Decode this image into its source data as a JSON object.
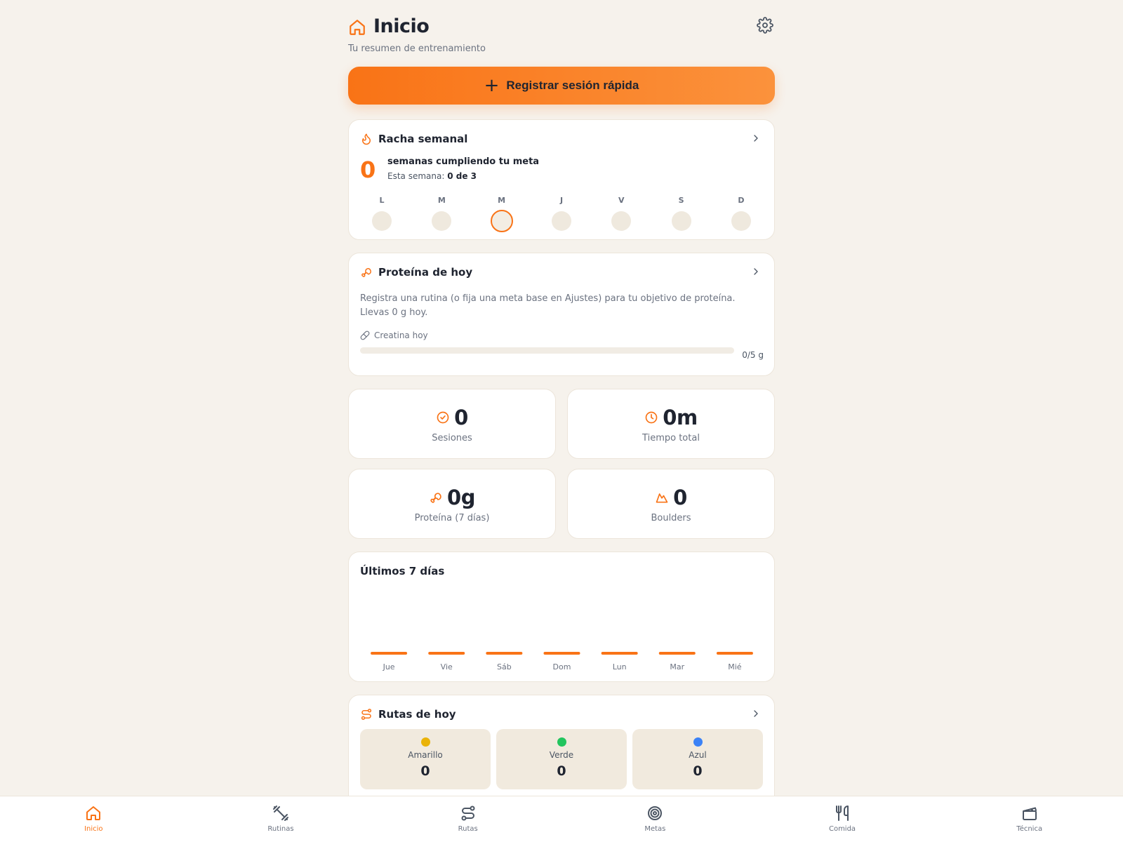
{
  "colors": {
    "accent": "#f97316",
    "background": "#f6f2ec",
    "card": "#ffffff",
    "yellow": "#eab308",
    "green": "#22c55e",
    "blue": "#3b82f6"
  },
  "header": {
    "title": "Inicio",
    "subtitle": "Tu resumen de entrenamiento",
    "icon": "home-icon",
    "settings_icon": "gear-icon"
  },
  "cta": {
    "plus": "+",
    "label": "Registrar sesión rápida"
  },
  "streak": {
    "title": "Racha semanal",
    "count": "0",
    "text": "semanas cumpliendo tu meta",
    "week_prefix": "Esta semana:",
    "week_value": "0 de 3",
    "days": [
      {
        "label": "L",
        "today": false
      },
      {
        "label": "M",
        "today": false
      },
      {
        "label": "M",
        "today": true
      },
      {
        "label": "J",
        "today": false
      },
      {
        "label": "V",
        "today": false
      },
      {
        "label": "S",
        "today": false
      },
      {
        "label": "D",
        "today": false
      }
    ]
  },
  "protein": {
    "title": "Proteína de hoy",
    "description": "Registra una rutina (o fija una meta base en Ajustes) para tu objetivo de proteína. Llevas 0 g hoy.",
    "creatine_label": "Creatina hoy",
    "creatine_value": "0/5 g",
    "creatine_progress": 0
  },
  "stats": {
    "sessions": {
      "value": "0",
      "label": "Sesiones"
    },
    "time": {
      "value": "0m",
      "label": "Tiempo total"
    },
    "protein": {
      "value": "0g",
      "label": "Proteína (7 días)"
    },
    "boulders": {
      "value": "0",
      "label": "Boulders"
    }
  },
  "chart": {
    "title": "Últimos 7 días"
  },
  "chart_data": {
    "type": "bar",
    "title": "Últimos 7 días",
    "categories": [
      "Jue",
      "Vie",
      "Sáb",
      "Dom",
      "Lun",
      "Mar",
      "Mié"
    ],
    "values": [
      0,
      0,
      0,
      0,
      0,
      0,
      0
    ],
    "xlabel": "",
    "ylabel": "",
    "grid": false
  },
  "routes": {
    "title": "Rutas de hoy",
    "items": [
      {
        "name": "Amarillo",
        "count": "0",
        "color": "#eab308"
      },
      {
        "name": "Verde",
        "count": "0",
        "color": "#22c55e"
      },
      {
        "name": "Azul",
        "count": "0",
        "color": "#3b82f6"
      }
    ]
  },
  "nav": {
    "items": [
      {
        "label": "Inicio",
        "icon": "home-icon",
        "active": true
      },
      {
        "label": "Rutinas",
        "icon": "dumbbell-icon",
        "active": false
      },
      {
        "label": "Rutas",
        "icon": "route-icon",
        "active": false
      },
      {
        "label": "Metas",
        "icon": "target-icon",
        "active": false
      },
      {
        "label": "Comida",
        "icon": "utensils-icon",
        "active": false
      },
      {
        "label": "Técnica",
        "icon": "clapperboard-icon",
        "active": false
      }
    ]
  }
}
